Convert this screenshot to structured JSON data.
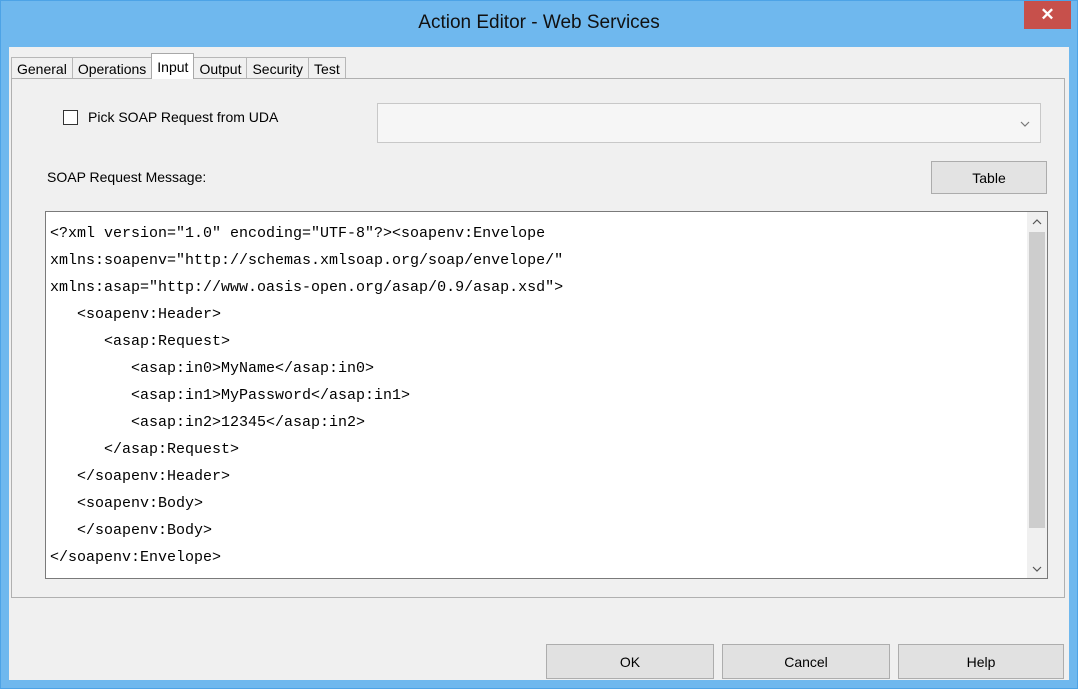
{
  "window": {
    "title": "Action Editor - Web Services",
    "close_label": "✕"
  },
  "tabs": [
    {
      "label": "General"
    },
    {
      "label": "Operations"
    },
    {
      "label": "Input",
      "active": true
    },
    {
      "label": "Output"
    },
    {
      "label": "Security"
    },
    {
      "label": "Test"
    }
  ],
  "input": {
    "pick_soap_label": "Pick SOAP Request from UDA",
    "pick_soap_checked": false,
    "uda_select_value": "",
    "request_label": "SOAP Request Message:",
    "table_button": "Table",
    "soap_lines": [
      "<?xml version=\"1.0\" encoding=\"UTF-8\"?><soapenv:Envelope",
      "xmlns:soapenv=\"http://schemas.xmlsoap.org/soap/envelope/\"",
      "xmlns:asap=\"http://www.oasis-open.org/asap/0.9/asap.xsd\">",
      "   <soapenv:Header>",
      "      <asap:Request>",
      "         <asap:in0>MyName</asap:in0>",
      "         <asap:in1>MyPassword</asap:in1>",
      "         <asap:in2>12345</asap:in2>",
      "      </asap:Request>",
      "   </soapenv:Header>",
      "   <soapenv:Body>",
      "   </soapenv:Body>",
      "</soapenv:Envelope>"
    ]
  },
  "buttons": {
    "ok": "OK",
    "cancel": "Cancel",
    "help": "Help"
  },
  "colors": {
    "title_bar": "#6fb8ee",
    "close_button": "#c7504b",
    "dialog_bg": "#f0f0f0"
  },
  "icons": {
    "close": "close-icon",
    "scroll_up": "chevron-up-icon",
    "scroll_down": "chevron-down-icon",
    "select": "chevron-down-icon"
  }
}
